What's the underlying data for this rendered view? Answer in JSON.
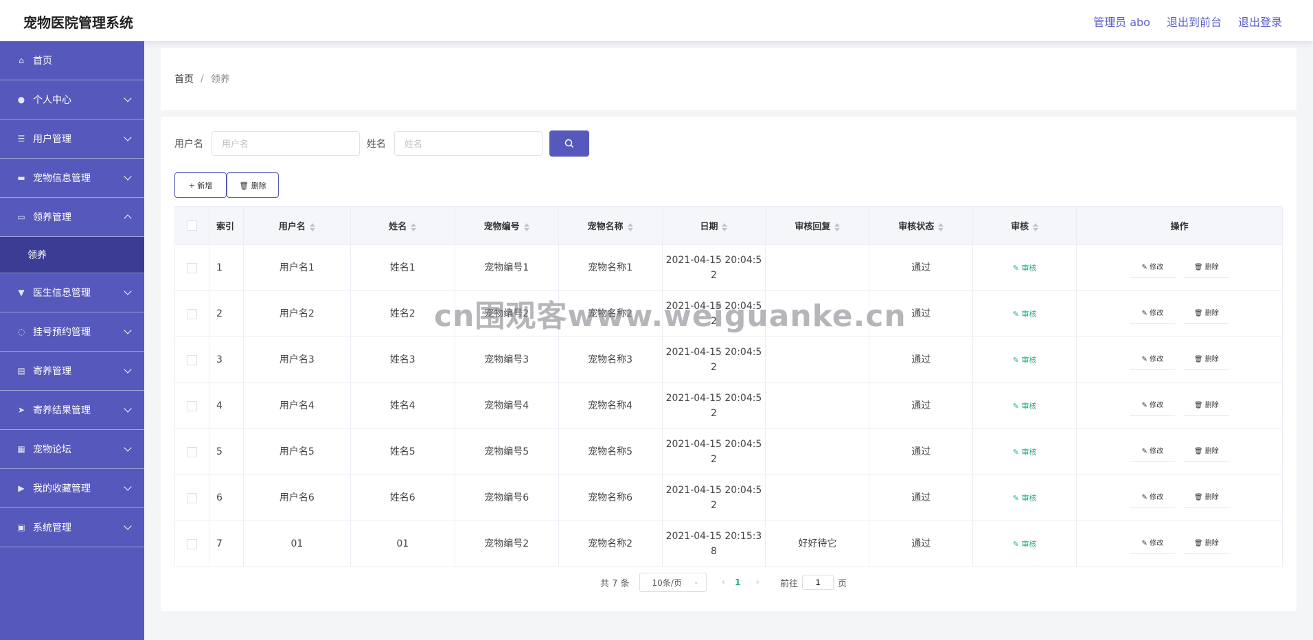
{
  "header": {
    "title": "宠物医院管理系统",
    "admin": "管理员 abo",
    "exit_front": "退出到前台",
    "logout": "退出登录"
  },
  "sidebar": {
    "items": [
      {
        "label": "首页",
        "icon": "home-icon"
      },
      {
        "label": "个人中心",
        "icon": "user-icon"
      },
      {
        "label": "用户管理",
        "icon": "list-icon"
      },
      {
        "label": "宠物信息管理",
        "icon": "chat-icon"
      },
      {
        "label": "领养管理",
        "icon": "message-icon"
      },
      {
        "label": "医生信息管理",
        "icon": "cup-icon"
      },
      {
        "label": "挂号预约管理",
        "icon": "power-icon"
      },
      {
        "label": "寄养管理",
        "icon": "clipboard-icon"
      },
      {
        "label": "寄养结果管理",
        "icon": "send-icon"
      },
      {
        "label": "宠物论坛",
        "icon": "grid-icon"
      },
      {
        "label": "我的收藏管理",
        "icon": "video-icon"
      },
      {
        "label": "系统管理",
        "icon": "box-icon"
      }
    ],
    "sub_item": "领养"
  },
  "breadcrumb": {
    "home": "首页",
    "sep": "/",
    "current": "领养"
  },
  "search": {
    "username_label": "用户名",
    "username_placeholder": "用户名",
    "name_label": "姓名",
    "name_placeholder": "姓名"
  },
  "actions": {
    "add": "+ 新增",
    "delete": "🗑 删除"
  },
  "table": {
    "headers": [
      "索引",
      "用户名",
      "姓名",
      "宠物编号",
      "宠物名称",
      "日期",
      "审核回复",
      "审核状态",
      "审核",
      "操作"
    ],
    "rows": [
      {
        "idx": "1",
        "user": "用户名1",
        "name": "姓名1",
        "petno": "宠物编号1",
        "petname": "宠物名称1",
        "date": "2021-04-15 20:04:5",
        "date2": "2",
        "reply": "",
        "status": "通过"
      },
      {
        "idx": "2",
        "user": "用户名2",
        "name": "姓名2",
        "petno": "宠物编号2",
        "petname": "宠物名称2",
        "date": "2021-04-15 20:04:5",
        "date2": "2",
        "reply": "",
        "status": "通过"
      },
      {
        "idx": "3",
        "user": "用户名3",
        "name": "姓名3",
        "petno": "宠物编号3",
        "petname": "宠物名称3",
        "date": "2021-04-15 20:04:5",
        "date2": "2",
        "reply": "",
        "status": "通过"
      },
      {
        "idx": "4",
        "user": "用户名4",
        "name": "姓名4",
        "petno": "宠物编号4",
        "petname": "宠物名称4",
        "date": "2021-04-15 20:04:5",
        "date2": "2",
        "reply": "",
        "status": "通过"
      },
      {
        "idx": "5",
        "user": "用户名5",
        "name": "姓名5",
        "petno": "宠物编号5",
        "petname": "宠物名称5",
        "date": "2021-04-15 20:04:5",
        "date2": "2",
        "reply": "",
        "status": "通过"
      },
      {
        "idx": "6",
        "user": "用户名6",
        "name": "姓名6",
        "petno": "宠物编号6",
        "petname": "宠物名称6",
        "date": "2021-04-15 20:04:5",
        "date2": "2",
        "reply": "",
        "status": "通过"
      },
      {
        "idx": "7",
        "user": "01",
        "name": "01",
        "petno": "宠物编号2",
        "petname": "宠物名称2",
        "date": "2021-04-15 20:15:3",
        "date2": "8",
        "reply": "好好待它",
        "status": "通过"
      }
    ],
    "audit_label": "审核",
    "edit_label": "修改",
    "delete_label": "删除"
  },
  "pagination": {
    "total": "共 7 条",
    "page_size": "10条/页",
    "current": "1",
    "goto_label": "前往",
    "goto_value": "1",
    "page_suffix": "页"
  },
  "watermark": "cn围观客www.weiguanke.cn",
  "colors": {
    "primary": "#5758bb",
    "sidebar_active": "#3b3d95",
    "success": "#19b47f"
  }
}
